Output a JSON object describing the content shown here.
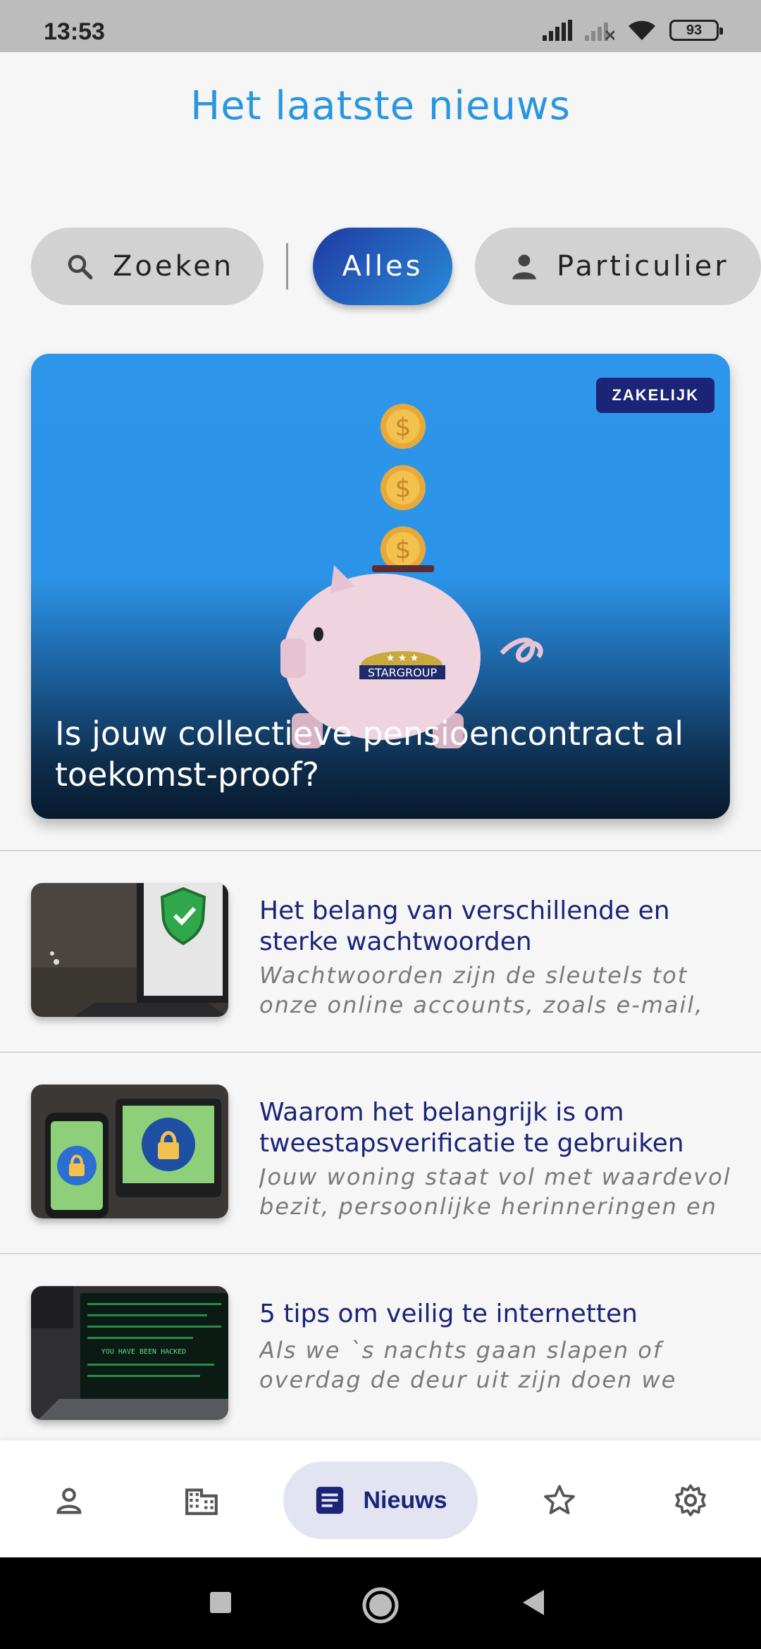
{
  "status_bar": {
    "time": "13:53",
    "battery": "93"
  },
  "page": {
    "title": "Het laatste nieuws"
  },
  "filters": {
    "search": "Zoeken",
    "all": "Alles",
    "private": "Particulier"
  },
  "hero": {
    "badge": "ZAKELIJK",
    "title": "Is jouw collectieve pensioencontract al toekomst-proof?",
    "logo_text": "STARGROUP"
  },
  "articles": [
    {
      "title": "Het belang van verschillende en sterke wachtwoorden",
      "excerpt": "Wachtwoorden zijn de sleutels tot onze online accounts, zoals e-mail, s…"
    },
    {
      "title": "Waarom het belangrijk is om tweestapsverificatie te gebruiken",
      "excerpt": "Jouw woning staat vol met waardevol bezit, persoonlijke herinneringen en …"
    },
    {
      "title": "5 tips om veilig te internetten",
      "excerpt": "Als we `s nachts gaan slapen of overdag de deur uit zijn doen we ons…",
      "thumb_text": "YOU HAVE BEEN HACKED"
    }
  ],
  "bottom_nav": {
    "active_label": "Nieuws"
  },
  "colors": {
    "accent": "#2a96e0",
    "navy": "#1b2477",
    "hero_blue": "#2d96ea"
  }
}
